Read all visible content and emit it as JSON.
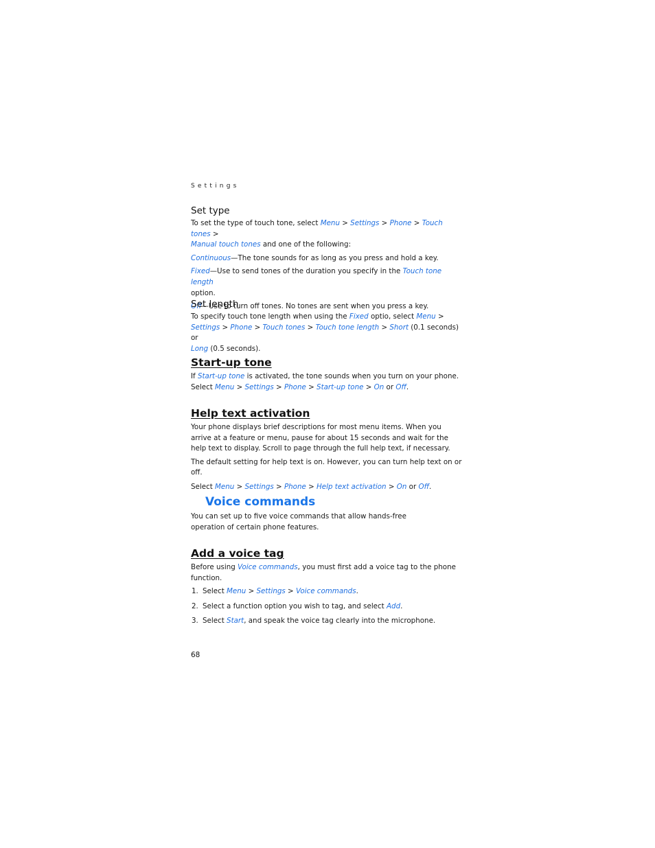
{
  "running_head": "Settings",
  "page_number": "68",
  "link_color": "#1f6fe0",
  "heading_color": "#1a75e8",
  "set_type": {
    "title": "Set type",
    "intro": {
      "t1": "To set the type of touch tone, select ",
      "l1": "Menu",
      "s1": " > ",
      "l2": "Settings",
      "s2": " > ",
      "l3": "Phone",
      "s3": " > ",
      "l4": "Touch tones",
      "s4": " > ",
      "l5": "Manual touch tones",
      "t2": " and one of the following:"
    },
    "continuous": {
      "term": "Continuous",
      "desc": "—The tone sounds for as long as you press and hold a key."
    },
    "fixed": {
      "term": "Fixed",
      "desc": "—Use to send tones of the duration you specify in the ",
      "link": "Touch tone length",
      "tail": " option."
    },
    "off": {
      "term": "Off",
      "desc": "—Use to turn off tones. No tones are sent when you press a key."
    }
  },
  "set_length": {
    "title": "Set length",
    "t1": "To specify touch tone length when using the ",
    "l1": "Fixed",
    "t2": " optio, select ",
    "l2": "Menu",
    "s1": " > ",
    "l3": "Settings",
    "s2": " > ",
    "l4": "Phone",
    "s3": " > ",
    "l5": "Touch tones",
    "s4": " > ",
    "l6": "Touch tone length",
    "s5": " > ",
    "l7": "Short",
    "t3": " (0.1 seconds) or ",
    "l8": "Long",
    "t4": " (0.5 seconds)."
  },
  "startup_tone": {
    "title": "Start-up tone",
    "t1": "If ",
    "l1": "Start-up tone",
    "t2": " is activated, the tone sounds when you turn on your phone.",
    "t3": "Select ",
    "l2": "Menu",
    "s1": " > ",
    "l3": "Settings",
    "s2": " > ",
    "l4": "Phone",
    "s3": " > ",
    "l5": "Start-up tone",
    "s4": " > ",
    "l6": "On",
    "t4": " or ",
    "l7": "Off",
    "t5": "."
  },
  "help_text": {
    "title": "Help text activation",
    "p1": "Your phone displays brief descriptions for most menu items. When you arrive at a feature or menu, pause for about 15 seconds and wait for the help text to display. Scroll to page through the full help text, if necessary.",
    "p2": "The default setting for help text is on. However, you can turn help text on or off.",
    "t1": "Select ",
    "l1": "Menu",
    "s1": " > ",
    "l2": "Settings",
    "s2": " > ",
    "l3": "Phone",
    "s3": " > ",
    "l4": "Help text activation",
    "s4": " > ",
    "l5": "On",
    "t2": " or ",
    "l6": "Off",
    "t3": "."
  },
  "voice_commands": {
    "title": "Voice commands",
    "p1": "You can set up to five voice commands that allow hands-free operation of certain phone features."
  },
  "add_voice_tag": {
    "title": "Add a voice tag",
    "t1": "Before using ",
    "l1": "Voice commands",
    "t2": ", you must first add a voice tag to the phone function.",
    "steps": [
      {
        "num": "1.",
        "t1": "Select ",
        "l1": "Menu",
        "s1": " > ",
        "l2": "Settings",
        "s2": " > ",
        "l3": "Voice commands",
        "t2": "."
      },
      {
        "num": "2.",
        "t1": "Select a function option you wish to tag, and select ",
        "l1": "Add",
        "t2": "."
      },
      {
        "num": "3.",
        "t1": "Select ",
        "l1": "Start",
        "t2": ", and speak the voice tag clearly into the microphone."
      }
    ]
  }
}
